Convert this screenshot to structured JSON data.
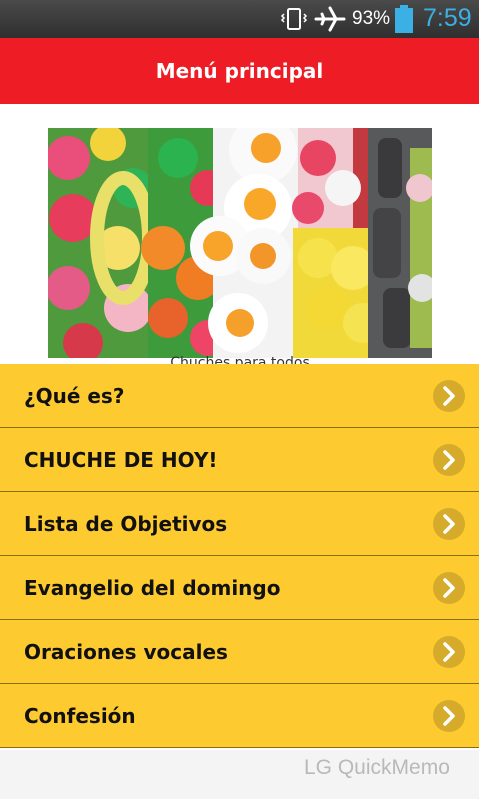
{
  "status_bar": {
    "battery_percent": "93%",
    "time": "7:59",
    "icons": [
      "vibrate-icon",
      "airplane-icon",
      "battery-icon"
    ],
    "clock_color": "#3bb0e4"
  },
  "header": {
    "title": "Menú principal",
    "color": "#ee1c24"
  },
  "banner": {
    "image": "candy-photo",
    "caption": "Chuches para todos"
  },
  "menu": {
    "items": [
      {
        "label": "¿Qué es?"
      },
      {
        "label": "CHUCHE DE HOY!"
      },
      {
        "label": "Lista de Objetivos"
      },
      {
        "label": "Evangelio del domingo"
      },
      {
        "label": "Oraciones vocales"
      },
      {
        "label": "Confesión"
      }
    ],
    "item_color": "#fdca2f",
    "chevron_color": "#d6ab2b"
  },
  "watermark": "LG QuickMemo"
}
